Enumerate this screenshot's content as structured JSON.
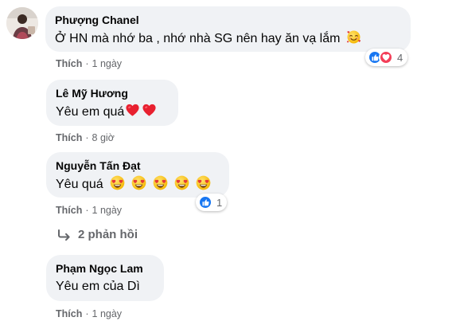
{
  "comments": [
    {
      "author": "Phượng Chanel",
      "text": "Ở HN mà nhớ ba , nhớ nhà SG nên hay ăn vạ lắm",
      "like_label": "Thích",
      "separator": "·",
      "time": "1 ngày",
      "reaction_count": "4",
      "reactions": [
        "like",
        "love"
      ],
      "emoji": "smiling-face-with-hearts"
    },
    {
      "author": "Lê Mỹ Hương",
      "text": "Yêu em quá",
      "like_label": "Thích",
      "separator": "·",
      "time": "8 giờ",
      "emoji": "red-heart"
    },
    {
      "author": "Nguyễn Tấn Đạt",
      "text": "Yêu quá",
      "like_label": "Thích",
      "separator": "·",
      "time": "1 ngày",
      "reaction_count": "1",
      "reactions": [
        "like"
      ],
      "emoji": "heart-eyes"
    },
    {
      "author": "Phạm Ngọc Lam",
      "text": "Yêu em của Dì",
      "like_label": "Thích",
      "separator": "·",
      "time": "1 ngày"
    }
  ],
  "replies": {
    "label": "2 phản hồi",
    "icon": "reply-arrow-icon"
  },
  "colors": {
    "bubble": "#f0f2f5",
    "meta_text": "#65676b",
    "like_blue": "#1877f2",
    "love_red": "#f33e58"
  }
}
